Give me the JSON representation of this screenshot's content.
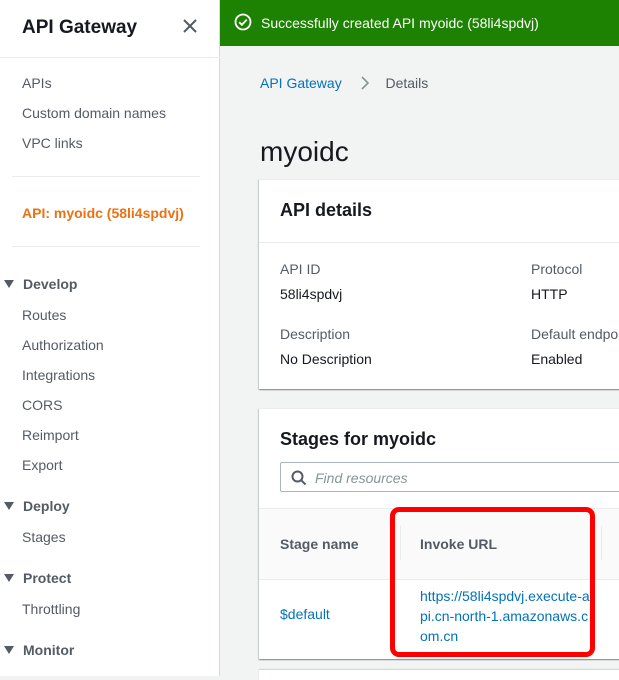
{
  "sidebar": {
    "title": "API Gateway",
    "top_items": [
      {
        "label": "APIs"
      },
      {
        "label": "Custom domain names"
      },
      {
        "label": "VPC links"
      }
    ],
    "active_api": "API: myoidc (58li4spdvj)",
    "sections": [
      {
        "label": "Develop",
        "items": [
          {
            "label": "Routes"
          },
          {
            "label": "Authorization"
          },
          {
            "label": "Integrations"
          },
          {
            "label": "CORS"
          },
          {
            "label": "Reimport"
          },
          {
            "label": "Export"
          }
        ]
      },
      {
        "label": "Deploy",
        "items": [
          {
            "label": "Stages"
          }
        ]
      },
      {
        "label": "Protect",
        "items": [
          {
            "label": "Throttling"
          }
        ]
      },
      {
        "label": "Monitor",
        "items": []
      }
    ]
  },
  "flash": {
    "message": "Successfully created API myoidc (58li4spdvj)",
    "icon": "check-circle-icon",
    "color": "#1d8102"
  },
  "breadcrumb": {
    "root": "API Gateway",
    "current": "Details"
  },
  "page": {
    "title": "myoidc"
  },
  "api_details": {
    "heading": "API details",
    "fields": [
      {
        "label": "API ID",
        "value": "58li4spdvj"
      },
      {
        "label": "Protocol",
        "value": "HTTP"
      },
      {
        "label": "Description",
        "value": "No Description"
      },
      {
        "label": "Default endpo",
        "value": "Enabled"
      }
    ]
  },
  "stages": {
    "heading": "Stages for myoidc",
    "search_placeholder": "Find resources",
    "columns": [
      "Stage name",
      "Invoke URL"
    ],
    "rows": [
      {
        "stage": "$default",
        "invoke_url": "https://58li4spdvj.execute-api.cn-north-1.amazonaws.com.cn"
      }
    ]
  },
  "colors": {
    "link": "#0073bb",
    "active_nav": "#ec7211",
    "highlight_box": "#ff0000"
  }
}
